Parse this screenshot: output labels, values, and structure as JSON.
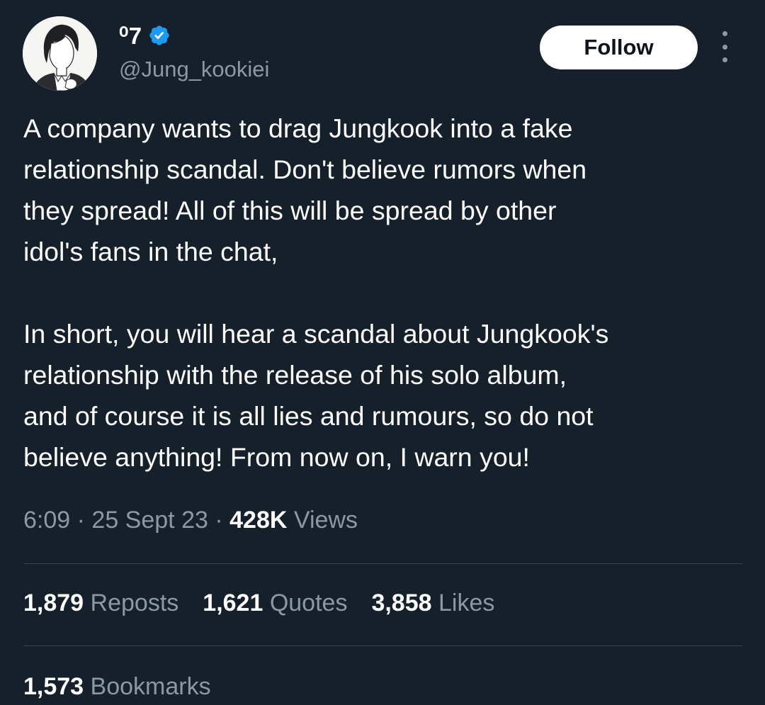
{
  "author": {
    "display_name": "⁰7",
    "handle": "@Jung_kookiei",
    "verified": true,
    "avatar_icon": "anime-boy-avatar"
  },
  "actions": {
    "follow_label": "Follow",
    "more_icon": "more-vertical-icon"
  },
  "tweet": {
    "paragraph1_lines": [
      "A company wants to drag Jungkook into a fake",
      "relationship scandal. Don't believe rumors when",
      "they spread! All of this will be spread by other",
      "idol's fans in the chat,"
    ],
    "paragraph2_lines": [
      "In short, you will hear a scandal about Jungkook's",
      "relationship with the release of his solo album,",
      "and of course it is all lies and rumours, so do not",
      "believe anything! From now on, I warn you!"
    ]
  },
  "meta": {
    "time": "6:09",
    "separator": "·",
    "date": "25 Sept 23",
    "views_count": "428K",
    "views_label": "Views"
  },
  "stats": {
    "reposts_count": "1,879",
    "reposts_label": "Reposts",
    "quotes_count": "1,621",
    "quotes_label": "Quotes",
    "likes_count": "3,858",
    "likes_label": "Likes",
    "bookmarks_count": "1,573",
    "bookmarks_label": "Bookmarks"
  },
  "colors": {
    "background": "#15202b",
    "text_primary": "#ffffff",
    "text_secondary": "#8b98a5",
    "verified_blue": "#1d9bf0",
    "divider": "#38444d"
  }
}
